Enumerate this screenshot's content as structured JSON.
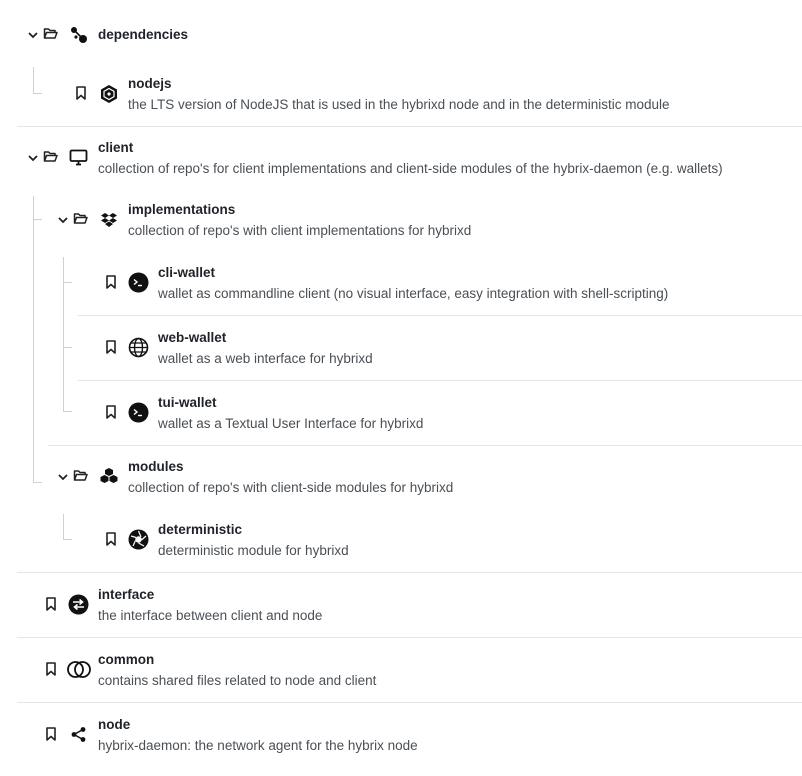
{
  "tree": {
    "dependencies": {
      "title": "dependencies",
      "icons": [
        "chevron-down-icon",
        "folder-open-icon",
        "nodes-icon"
      ],
      "children": {
        "nodejs": {
          "title": "nodejs",
          "description": "the LTS version of NodeJS that is used in the hybrixd node and in the deterministic module",
          "icons": [
            "bookmark-icon",
            "nodejs-icon"
          ]
        }
      }
    },
    "client": {
      "title": "client",
      "description": "collection of repo's for client implementations and client-side modules of the hybrix-daemon (e.g. wallets)",
      "icons": [
        "chevron-down-icon",
        "folder-open-icon",
        "desktop-icon"
      ],
      "implementations": {
        "title": "implementations",
        "description": "collection of repo's with client implementations for hybrixd",
        "icons": [
          "chevron-down-icon",
          "folder-open-icon",
          "dropbox-icon"
        ],
        "items": [
          {
            "title": "cli-wallet",
            "description": "wallet as commandline client (no visual interface, easy integration with shell-scripting)",
            "icon": "terminal-icon"
          },
          {
            "title": "web-wallet",
            "description": "wallet as a web interface for hybrixd",
            "icon": "globe-icon"
          },
          {
            "title": "tui-wallet",
            "description": "wallet as a Textual User Interface for hybrixd",
            "icon": "terminal-icon"
          }
        ]
      },
      "modules": {
        "title": "modules",
        "description": "collection of repo's with client-side modules for hybrixd",
        "icons": [
          "chevron-down-icon",
          "folder-open-icon",
          "cubes-icon"
        ],
        "items": [
          {
            "title": "deterministic",
            "description": "deterministic module for hybrixd",
            "icon": "aperture-icon"
          }
        ]
      }
    },
    "interface": {
      "title": "interface",
      "description": "the interface between client and node",
      "icon": "exchange-icon"
    },
    "common": {
      "title": "common",
      "description": "contains shared files related to node and client",
      "icon": "rings-icon"
    },
    "node": {
      "title": "node",
      "description": "hybrix-daemon: the network agent for the hybrix node",
      "icon": "share-icon"
    }
  }
}
